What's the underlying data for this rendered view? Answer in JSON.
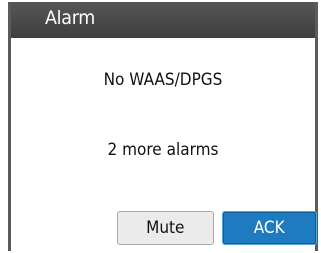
{
  "dialog": {
    "title": "Alarm",
    "message": "No WAAS/DPGS",
    "more_alarms": "2 more alarms",
    "buttons": {
      "mute_label": "Mute",
      "ack_label": "ACK"
    }
  },
  "colors": {
    "titlebar": "#4a4a4a",
    "ack_button": "#1f7bbf",
    "mute_button": "#ebebeb"
  }
}
